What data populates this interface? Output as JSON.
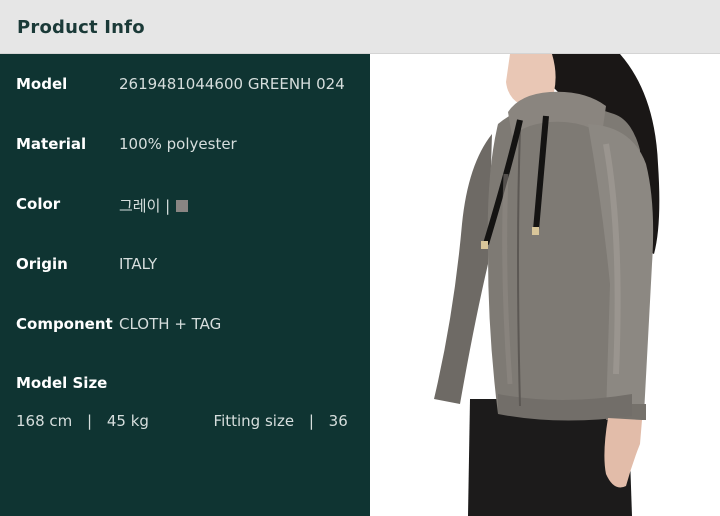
{
  "header": {
    "title": "Product Info"
  },
  "info_rows": [
    {
      "label": "Model",
      "value": "2619481044600 GREENH 024"
    },
    {
      "label": "Material",
      "value": "100% polyester"
    },
    {
      "label": "Color",
      "value": "그레이 |"
    },
    {
      "label": "Origin",
      "value": "ITALY"
    },
    {
      "label": "Component",
      "value": "CLOTH + TAG"
    }
  ],
  "model_size": {
    "label": "Model Size",
    "height": "168 cm",
    "separator": "|",
    "weight": "45 kg",
    "fitting_label": "Fitting size",
    "fitting_value": "36"
  },
  "colors": {
    "header_bg": "#e6e6e6",
    "panel_bg": "#0f3432",
    "title": "#1b3a38",
    "swatch_gray": "#8a8583",
    "jacket": "#7e7a74"
  }
}
